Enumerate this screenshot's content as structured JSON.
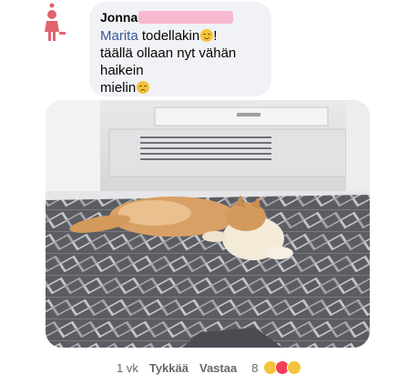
{
  "comment": {
    "author": "Jonna",
    "mention": "Marita",
    "line1_rest": " todellakin",
    "line1_end": "!",
    "line2": "täällä ollaan nyt vähän haikein",
    "line3": "mielin"
  },
  "actions": {
    "time": "1 vk",
    "like_label": "Tykkää",
    "reply_label": "Vastaa",
    "reaction_count": "8"
  },
  "icons": {
    "avatar": "female-avatar-icon",
    "emoji_grin": "grinning-emoji-icon",
    "emoji_sad": "sad-emoji-icon",
    "reactions": [
      "haha-reaction-icon",
      "love-reaction-icon",
      "sad-reaction-icon"
    ]
  },
  "colors": {
    "bubble": "#f0f2f5",
    "mention": "#385898",
    "avatar": "#e0646e",
    "redaction": "#f7b9cf"
  }
}
